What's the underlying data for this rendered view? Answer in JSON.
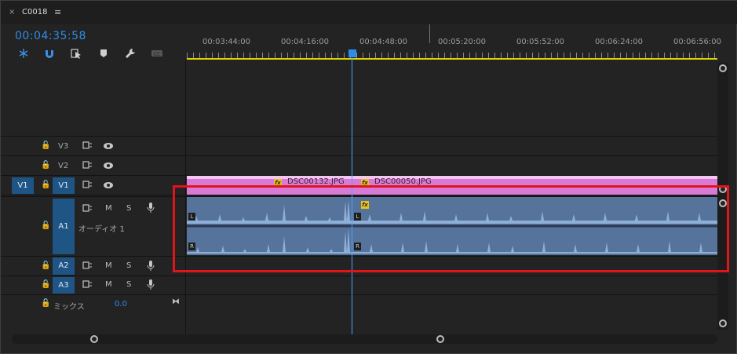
{
  "tab": {
    "close": "×",
    "title": "C0018",
    "menu": "≡"
  },
  "timecode": "00:04:35:58",
  "ruler_labels": [
    "00:03:44:00",
    "00:04:16:00",
    "00:04:48:00",
    "00:05:20:00",
    "00:05:52:00",
    "00:06:24:00",
    "00:06:56:00"
  ],
  "tools": [
    "snap-icon",
    "magnet-icon",
    "linked-selection-icon",
    "marker-icon",
    "wrench-icon",
    "captions-icon"
  ],
  "tracks": {
    "v3": {
      "name": "V3"
    },
    "v2": {
      "name": "V2"
    },
    "v1": {
      "source": "V1",
      "name": "V1"
    },
    "a1": {
      "name": "A1",
      "label": "オーディオ 1",
      "mute": "M",
      "solo": "S"
    },
    "a2": {
      "name": "A2",
      "mute": "M",
      "solo": "S"
    },
    "a3": {
      "name": "A3",
      "mute": "M",
      "solo": "S"
    },
    "mix": {
      "label": "ミックス",
      "value": "0.0"
    }
  },
  "clips": {
    "video1": {
      "name": "DSC00132.JPG",
      "fx": "fx"
    },
    "video2": {
      "name": "DSC00050.JPG",
      "fx": "fx"
    },
    "audio_fx": "fx",
    "channel_left": "L",
    "channel_right": "R"
  },
  "colors": {
    "accent": "#2d8ceb",
    "video_clip": "#d97ad6",
    "audio_clip": "#56739c",
    "highlight": "#e0151b"
  }
}
